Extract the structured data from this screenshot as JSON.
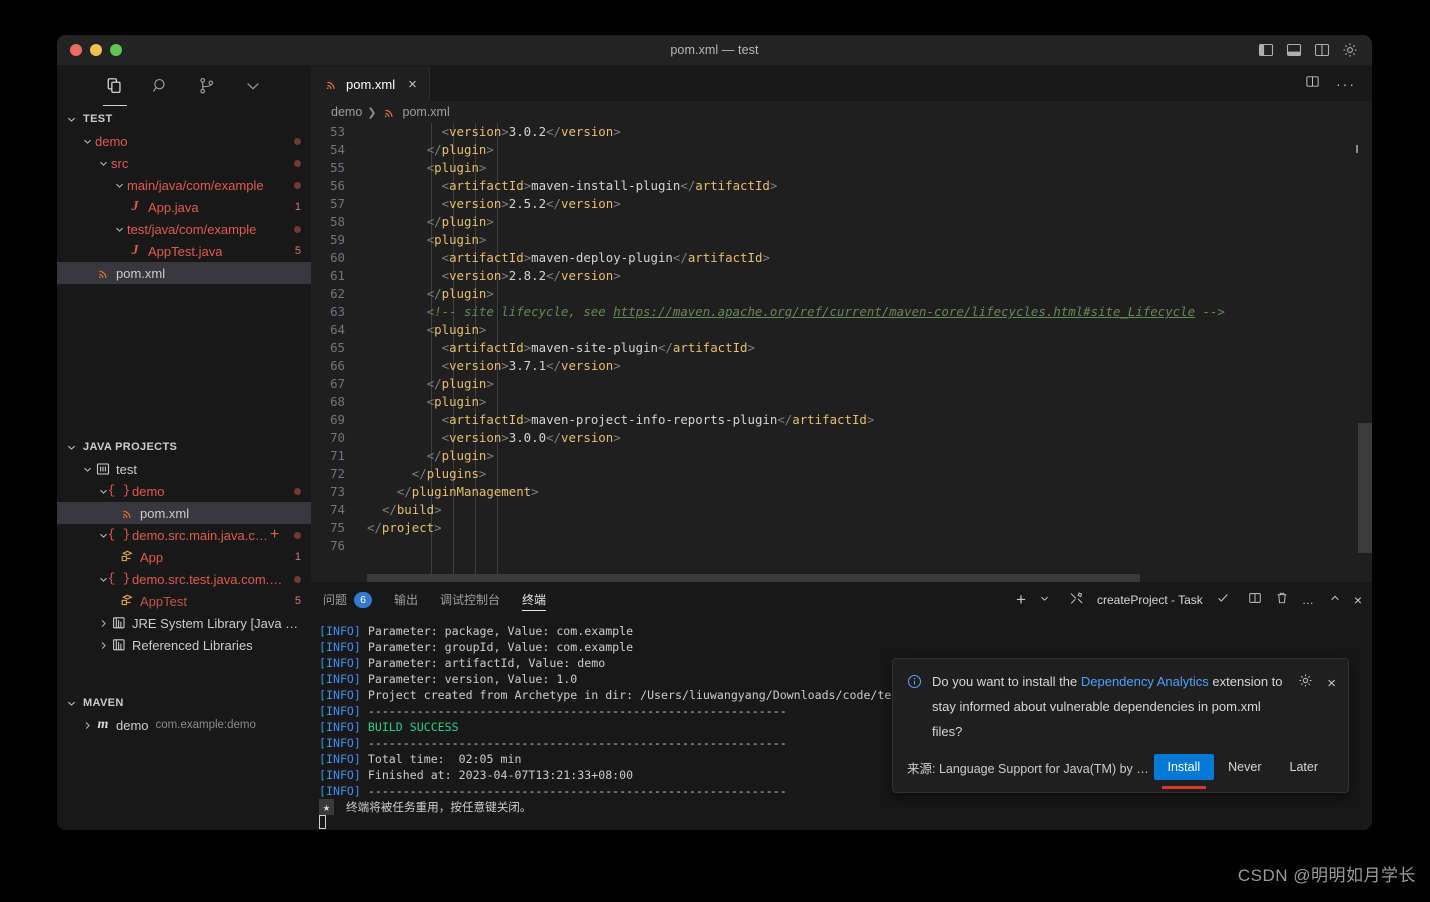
{
  "window": {
    "title": "pom.xml — test",
    "traffic_lights": [
      "close",
      "minimize",
      "maximize"
    ],
    "layout_icons": [
      "toggle-primary-sidebar",
      "toggle-panel",
      "toggle-secondary-sidebar",
      "manage-settings-gear"
    ]
  },
  "activity_bar": {
    "items": [
      {
        "name": "explorer",
        "icon": "files-icon",
        "active": true
      },
      {
        "name": "search",
        "icon": "search-icon",
        "active": false
      },
      {
        "name": "source-control",
        "icon": "source-control-icon",
        "active": false
      },
      {
        "name": "more",
        "icon": "chevron-down-icon",
        "active": false
      }
    ]
  },
  "sidebar": {
    "explorer": {
      "title": "TEST",
      "rows": [
        {
          "label": "demo",
          "indent": 1,
          "arrow": "down",
          "icon": "none",
          "color": "err",
          "marker": "dot"
        },
        {
          "label": "src",
          "indent": 2,
          "arrow": "down",
          "icon": "none",
          "color": "err",
          "marker": "dot"
        },
        {
          "label": "main/java/com/example",
          "indent": 3,
          "arrow": "down",
          "icon": "none",
          "color": "err",
          "marker": "dot"
        },
        {
          "label": "App.java",
          "indent": 4,
          "arrow": "none",
          "icon": "java-icon",
          "color": "err",
          "marker": "1"
        },
        {
          "label": "test/java/com/example",
          "indent": 3,
          "arrow": "down",
          "icon": "none",
          "color": "err",
          "marker": "dot"
        },
        {
          "label": "AppTest.java",
          "indent": 4,
          "arrow": "none",
          "icon": "java-icon",
          "color": "err",
          "marker": "5"
        },
        {
          "label": "pom.xml",
          "indent": 2,
          "arrow": "none",
          "icon": "xml-icon",
          "color": "plain",
          "marker": "none",
          "selected": true
        }
      ]
    },
    "java_projects": {
      "title": "JAVA PROJECTS",
      "rows": [
        {
          "label": "test",
          "indent": 1,
          "arrow": "down",
          "icon": "project-icon",
          "color": "plain",
          "marker": "none"
        },
        {
          "label": "demo",
          "indent": 2,
          "arrow": "down",
          "icon": "package-icon",
          "color": "err",
          "marker": "dot"
        },
        {
          "label": "pom.xml",
          "indent": 3,
          "arrow": "none",
          "icon": "xml-icon",
          "color": "plain",
          "marker": "none",
          "selected": true
        },
        {
          "label": "demo.src.main.java.c…",
          "indent": 2,
          "arrow": "down",
          "icon": "package-icon",
          "color": "err",
          "marker": "dot",
          "plus": true
        },
        {
          "label": "App",
          "indent": 3,
          "arrow": "none",
          "icon": "class-icon",
          "color": "err",
          "marker": "1"
        },
        {
          "label": "demo.src.test.java.com.…",
          "indent": 2,
          "arrow": "down",
          "icon": "package-icon",
          "color": "err",
          "marker": "dot"
        },
        {
          "label": "AppTest",
          "indent": 3,
          "arrow": "none",
          "icon": "class-icon",
          "color": "err",
          "marker": "5"
        },
        {
          "label": "JRE System Library [Java S…",
          "indent": 2,
          "arrow": "right",
          "icon": "library-icon",
          "color": "plain",
          "marker": "none"
        },
        {
          "label": "Referenced Libraries",
          "indent": 2,
          "arrow": "right",
          "icon": "library-icon",
          "color": "plain",
          "marker": "none"
        }
      ]
    },
    "maven": {
      "title": "MAVEN",
      "rows": [
        {
          "label": "demo",
          "sublabel": "com.example:demo",
          "indent": 1,
          "arrow": "right",
          "icon": "maven-icon",
          "color": "plain",
          "marker": "none"
        }
      ]
    }
  },
  "editor": {
    "tab": {
      "label": "pom.xml",
      "icon": "xml-icon",
      "close": "×"
    },
    "tab_actions": [
      "split-editor-icon",
      "more-actions-icon"
    ],
    "breadcrumb": [
      "demo",
      "pom.xml"
    ],
    "lines": [
      {
        "n": 53,
        "indent": 10,
        "parts": [
          [
            "punc",
            "<"
          ],
          [
            "tag",
            "version"
          ],
          [
            "punc",
            ">"
          ],
          [
            "val",
            "3.0.2"
          ],
          [
            "punc",
            "</"
          ],
          [
            "tag",
            "version"
          ],
          [
            "punc",
            ">"
          ]
        ]
      },
      {
        "n": 54,
        "indent": 8,
        "parts": [
          [
            "punc",
            "</"
          ],
          [
            "tag",
            "plugin"
          ],
          [
            "punc",
            ">"
          ]
        ]
      },
      {
        "n": 55,
        "indent": 8,
        "parts": [
          [
            "punc",
            "<"
          ],
          [
            "tag",
            "plugin"
          ],
          [
            "punc",
            ">"
          ]
        ]
      },
      {
        "n": 56,
        "indent": 10,
        "parts": [
          [
            "punc",
            "<"
          ],
          [
            "tag",
            "artifactId"
          ],
          [
            "punc",
            ">"
          ],
          [
            "val",
            "maven-install-plugin"
          ],
          [
            "punc",
            "</"
          ],
          [
            "tag",
            "artifactId"
          ],
          [
            "punc",
            ">"
          ]
        ]
      },
      {
        "n": 57,
        "indent": 10,
        "parts": [
          [
            "punc",
            "<"
          ],
          [
            "tag",
            "version"
          ],
          [
            "punc",
            ">"
          ],
          [
            "val",
            "2.5.2"
          ],
          [
            "punc",
            "</"
          ],
          [
            "tag",
            "version"
          ],
          [
            "punc",
            ">"
          ]
        ]
      },
      {
        "n": 58,
        "indent": 8,
        "parts": [
          [
            "punc",
            "</"
          ],
          [
            "tag",
            "plugin"
          ],
          [
            "punc",
            ">"
          ]
        ]
      },
      {
        "n": 59,
        "indent": 8,
        "parts": [
          [
            "punc",
            "<"
          ],
          [
            "tag",
            "plugin"
          ],
          [
            "punc",
            ">"
          ]
        ]
      },
      {
        "n": 60,
        "indent": 10,
        "parts": [
          [
            "punc",
            "<"
          ],
          [
            "tag",
            "artifactId"
          ],
          [
            "punc",
            ">"
          ],
          [
            "val",
            "maven-deploy-plugin"
          ],
          [
            "punc",
            "</"
          ],
          [
            "tag",
            "artifactId"
          ],
          [
            "punc",
            ">"
          ]
        ]
      },
      {
        "n": 61,
        "indent": 10,
        "parts": [
          [
            "punc",
            "<"
          ],
          [
            "tag",
            "version"
          ],
          [
            "punc",
            ">"
          ],
          [
            "val",
            "2.8.2"
          ],
          [
            "punc",
            "</"
          ],
          [
            "tag",
            "version"
          ],
          [
            "punc",
            ">"
          ]
        ]
      },
      {
        "n": 62,
        "indent": 8,
        "parts": [
          [
            "punc",
            "</"
          ],
          [
            "tag",
            "plugin"
          ],
          [
            "punc",
            ">"
          ]
        ]
      },
      {
        "n": 63,
        "indent": 8,
        "parts": [
          [
            "com",
            "<!-- site lifecycle, see "
          ],
          [
            "link",
            "https://maven.apache.org/ref/current/maven-core/lifecycles.html#site_Lifecycle"
          ],
          [
            "com",
            " -->"
          ]
        ]
      },
      {
        "n": 64,
        "indent": 8,
        "parts": [
          [
            "punc",
            "<"
          ],
          [
            "tag",
            "plugin"
          ],
          [
            "punc",
            ">"
          ]
        ]
      },
      {
        "n": 65,
        "indent": 10,
        "parts": [
          [
            "punc",
            "<"
          ],
          [
            "tag",
            "artifactId"
          ],
          [
            "punc",
            ">"
          ],
          [
            "val",
            "maven-site-plugin"
          ],
          [
            "punc",
            "</"
          ],
          [
            "tag",
            "artifactId"
          ],
          [
            "punc",
            ">"
          ]
        ]
      },
      {
        "n": 66,
        "indent": 10,
        "parts": [
          [
            "punc",
            "<"
          ],
          [
            "tag",
            "version"
          ],
          [
            "punc",
            ">"
          ],
          [
            "val",
            "3.7.1"
          ],
          [
            "punc",
            "</"
          ],
          [
            "tag",
            "version"
          ],
          [
            "punc",
            ">"
          ]
        ]
      },
      {
        "n": 67,
        "indent": 8,
        "parts": [
          [
            "punc",
            "</"
          ],
          [
            "tag",
            "plugin"
          ],
          [
            "punc",
            ">"
          ]
        ]
      },
      {
        "n": 68,
        "indent": 8,
        "parts": [
          [
            "punc",
            "<"
          ],
          [
            "tag",
            "plugin"
          ],
          [
            "punc",
            ">"
          ]
        ]
      },
      {
        "n": 69,
        "indent": 10,
        "parts": [
          [
            "punc",
            "<"
          ],
          [
            "tag",
            "artifactId"
          ],
          [
            "punc",
            ">"
          ],
          [
            "val",
            "maven-project-info-reports-plugin"
          ],
          [
            "punc",
            "</"
          ],
          [
            "tag",
            "artifactId"
          ],
          [
            "punc",
            ">"
          ]
        ]
      },
      {
        "n": 70,
        "indent": 10,
        "parts": [
          [
            "punc",
            "<"
          ],
          [
            "tag",
            "version"
          ],
          [
            "punc",
            ">"
          ],
          [
            "val",
            "3.0.0"
          ],
          [
            "punc",
            "</"
          ],
          [
            "tag",
            "version"
          ],
          [
            "punc",
            ">"
          ]
        ]
      },
      {
        "n": 71,
        "indent": 8,
        "parts": [
          [
            "punc",
            "</"
          ],
          [
            "tag",
            "plugin"
          ],
          [
            "punc",
            ">"
          ]
        ]
      },
      {
        "n": 72,
        "indent": 6,
        "parts": [
          [
            "punc",
            "</"
          ],
          [
            "tag",
            "plugins"
          ],
          [
            "punc",
            ">"
          ]
        ]
      },
      {
        "n": 73,
        "indent": 4,
        "parts": [
          [
            "punc",
            "</"
          ],
          [
            "tag",
            "pluginManagement"
          ],
          [
            "punc",
            ">"
          ]
        ]
      },
      {
        "n": 74,
        "indent": 2,
        "parts": [
          [
            "punc",
            "</"
          ],
          [
            "tag",
            "build"
          ],
          [
            "punc",
            ">"
          ]
        ]
      },
      {
        "n": 75,
        "indent": 0,
        "parts": [
          [
            "punc",
            "</"
          ],
          [
            "tag",
            "project"
          ],
          [
            "punc",
            ">"
          ]
        ]
      },
      {
        "n": 76,
        "indent": 0,
        "parts": []
      }
    ]
  },
  "panel": {
    "tabs": [
      {
        "label": "问题",
        "badge": "6",
        "active": false
      },
      {
        "label": "输出",
        "badge": "",
        "active": false
      },
      {
        "label": "调试控制台",
        "badge": "",
        "active": false
      },
      {
        "label": "终端",
        "badge": "",
        "active": true
      }
    ],
    "actions": {
      "new_terminal": "+",
      "split_dropdown": "chevron-down-icon",
      "task_icon": "tools-icon",
      "task_label": "createProject - Task",
      "task_status": "check-icon",
      "split_terminal": "split-icon",
      "kill_terminal": "trash-icon",
      "more": "…",
      "maximize": "chevron-up-icon",
      "close": "×"
    },
    "terminal_lines": [
      [
        [
          "info",
          "[INFO]"
        ],
        [
          "plain",
          " Parameter: package, Value: com.example"
        ]
      ],
      [
        [
          "info",
          "[INFO]"
        ],
        [
          "plain",
          " Parameter: groupId, Value: com.example"
        ]
      ],
      [
        [
          "info",
          "[INFO]"
        ],
        [
          "plain",
          " Parameter: artifactId, Value: demo"
        ]
      ],
      [
        [
          "info",
          "[INFO]"
        ],
        [
          "plain",
          " Parameter: version, Value: 1.0"
        ]
      ],
      [
        [
          "info",
          "[INFO]"
        ],
        [
          "plain",
          " Project created from Archetype in dir: /Users/liuwangyang/Downloads/code/tes"
        ]
      ],
      [
        [
          "info",
          "[INFO]"
        ],
        [
          "plain",
          " ------------------------------------------------------------"
        ]
      ],
      [
        [
          "info",
          "[INFO]"
        ],
        [
          "succ",
          " BUILD SUCCESS"
        ]
      ],
      [
        [
          "info",
          "[INFO]"
        ],
        [
          "plain",
          " ------------------------------------------------------------"
        ]
      ],
      [
        [
          "info",
          "[INFO]"
        ],
        [
          "plain",
          " Total time:  02:05 min"
        ]
      ],
      [
        [
          "info",
          "[INFO]"
        ],
        [
          "plain",
          " Finished at: 2023-04-07T13:21:33+08:00"
        ]
      ],
      [
        [
          "info",
          "[INFO]"
        ],
        [
          "plain",
          " ------------------------------------------------------------"
        ]
      ],
      [
        [
          "star",
          "★"
        ],
        [
          "plain",
          " 终端将被任务重用，按任意键关闭。"
        ]
      ]
    ]
  },
  "notification": {
    "icon": "info-icon",
    "message_before": "Do you want to install the ",
    "message_link": "Dependency Analytics",
    "message_after": " extension to stay informed about vulnerable dependencies in pom.xml files?",
    "gear": "settings-gear-icon",
    "close": "×",
    "source": "来源: Language Support for Java(TM) by …",
    "buttons": [
      {
        "label": "Install",
        "primary": true
      },
      {
        "label": "Never",
        "primary": false
      },
      {
        "label": "Later",
        "primary": false
      }
    ]
  },
  "watermark": "CSDN @明明如月学长",
  "colors": {
    "accent": "#0078d4",
    "error": "#e05a4e",
    "tag": "#e8bf6a",
    "comment": "#6a8759",
    "info": "#3b8eea",
    "success": "#23d18b",
    "link": "#4da0ff"
  }
}
